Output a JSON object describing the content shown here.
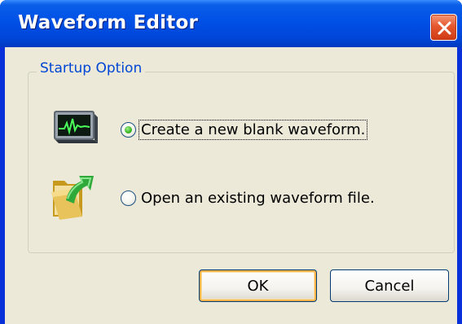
{
  "window": {
    "title": "Waveform Editor"
  },
  "group": {
    "label": "Startup Option"
  },
  "options": [
    {
      "label": "Create a new blank waveform.",
      "selected": true,
      "icon": "monitor-waveform-icon"
    },
    {
      "label": "Open an existing waveform file.",
      "selected": false,
      "icon": "open-folder-icon"
    }
  ],
  "buttons": {
    "ok_label": "OK",
    "cancel_label": "Cancel"
  },
  "colors": {
    "titlebar": "#0050e6",
    "client_background": "#ece9d8",
    "group_label": "#0046d5",
    "close_button": "#e6582f",
    "selected_radio": "#3fbb2b"
  }
}
